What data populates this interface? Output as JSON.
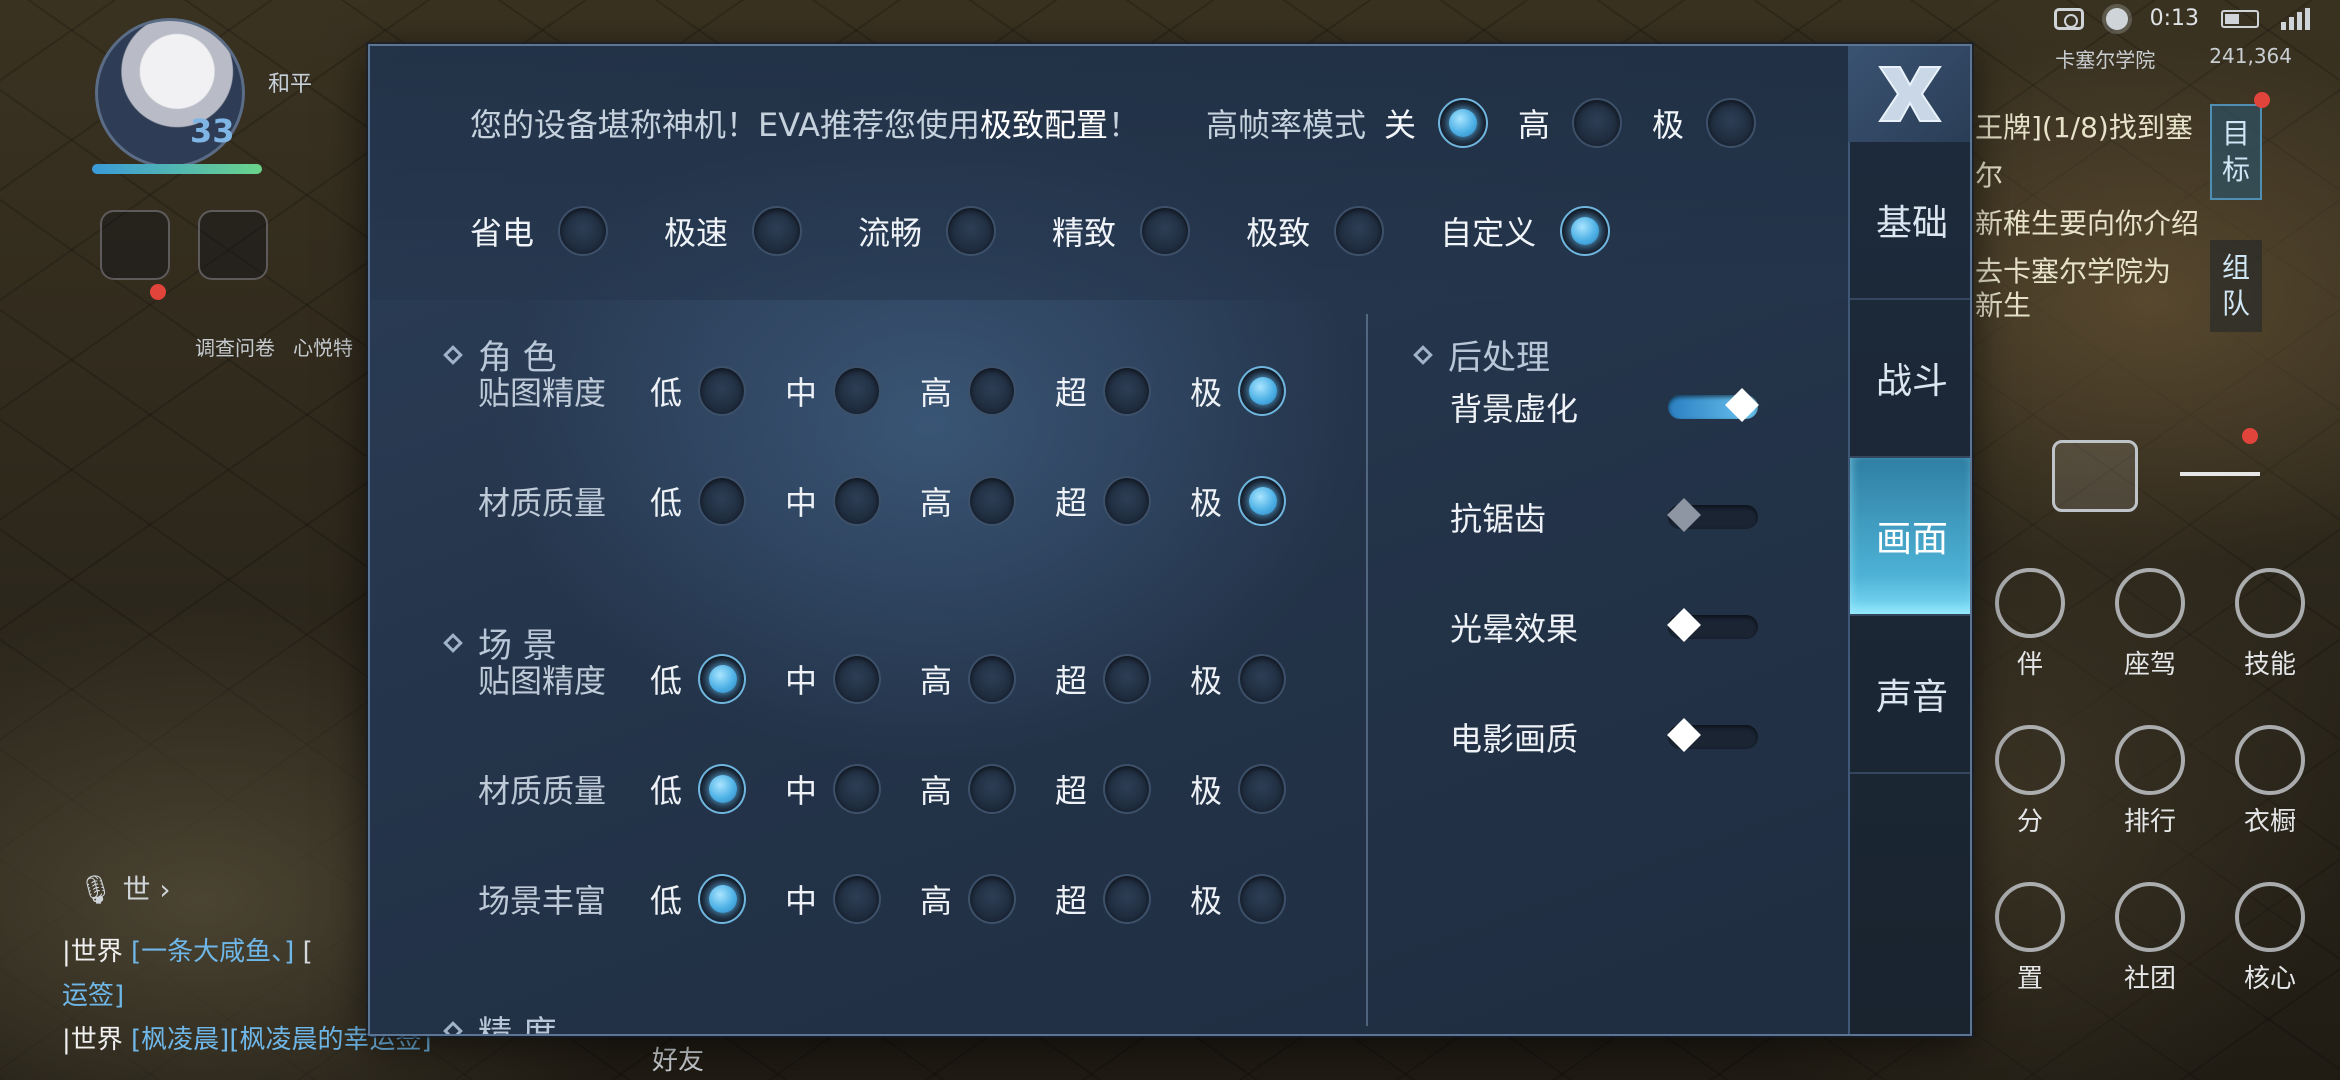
{
  "status_bar": {
    "time": "0:13",
    "school": "卡塞尔学院",
    "coins": "241,364"
  },
  "player": {
    "level": "33",
    "name": "和平"
  },
  "left_hud": {
    "labels": [
      "调查问卷",
      "心悦特"
    ]
  },
  "chat": {
    "mic_label": "世",
    "lines": [
      {
        "channel": "|世界",
        "name": "[一条大咸鱼、]",
        "rest": "["
      },
      {
        "channel": "运签]",
        "name": "",
        "rest": ""
      },
      {
        "channel": "|世界",
        "name": "[枫凌晨]",
        "rest": "[枫凌晨的幸运签]"
      }
    ],
    "friends_label": "好友"
  },
  "quest": {
    "lines": [
      "王牌](1/8)找到塞尔",
      "新稚生要向你介绍",
      "去卡塞尔学院为",
      "新生"
    ],
    "tab_goal": "目标",
    "tab_team": "组队"
  },
  "right_grid": {
    "items": [
      "伴",
      "座驾",
      "技能",
      "分",
      "排行",
      "衣橱",
      "置",
      "社团",
      "核心"
    ]
  },
  "panel": {
    "recommend_prefix": "您的设备堪称神机！EVA推荐您使用",
    "recommend_bold": "极致配置",
    "recommend_suffix": "！",
    "high_frame": {
      "label": "高帧率模式",
      "options": [
        "关",
        "高",
        "极"
      ],
      "selected": "关"
    },
    "presets": {
      "options": [
        "省电",
        "极速",
        "流畅",
        "精致",
        "极致",
        "自定义"
      ],
      "selected": "自定义"
    },
    "quality_levels": [
      "低",
      "中",
      "高",
      "超",
      "极"
    ],
    "sections": {
      "character": {
        "title": "角 色",
        "rows": [
          {
            "name": "贴图精度",
            "selected": "极"
          },
          {
            "name": "材质质量",
            "selected": "极"
          }
        ]
      },
      "scene": {
        "title": "场 景",
        "rows": [
          {
            "name": "贴图精度",
            "selected": "低"
          },
          {
            "name": "材质质量",
            "selected": "低"
          },
          {
            "name": "场景丰富",
            "selected": "低"
          }
        ]
      },
      "precision": {
        "title": "精 度"
      },
      "post": {
        "title": "后处理",
        "toggles": [
          {
            "name": "背景虚化",
            "state": "on"
          },
          {
            "name": "抗锯齿",
            "state": "disabled"
          },
          {
            "name": "光晕效果",
            "state": "off"
          },
          {
            "name": "电影画质",
            "state": "off"
          }
        ]
      }
    },
    "tabs": [
      {
        "label": "基础",
        "active": false
      },
      {
        "label": "战斗",
        "active": false
      },
      {
        "label": "画面",
        "active": true
      },
      {
        "label": "声音",
        "active": false
      }
    ],
    "colors": {
      "accent": "#4fb2e6",
      "active_tab": "#4db2d6"
    }
  }
}
